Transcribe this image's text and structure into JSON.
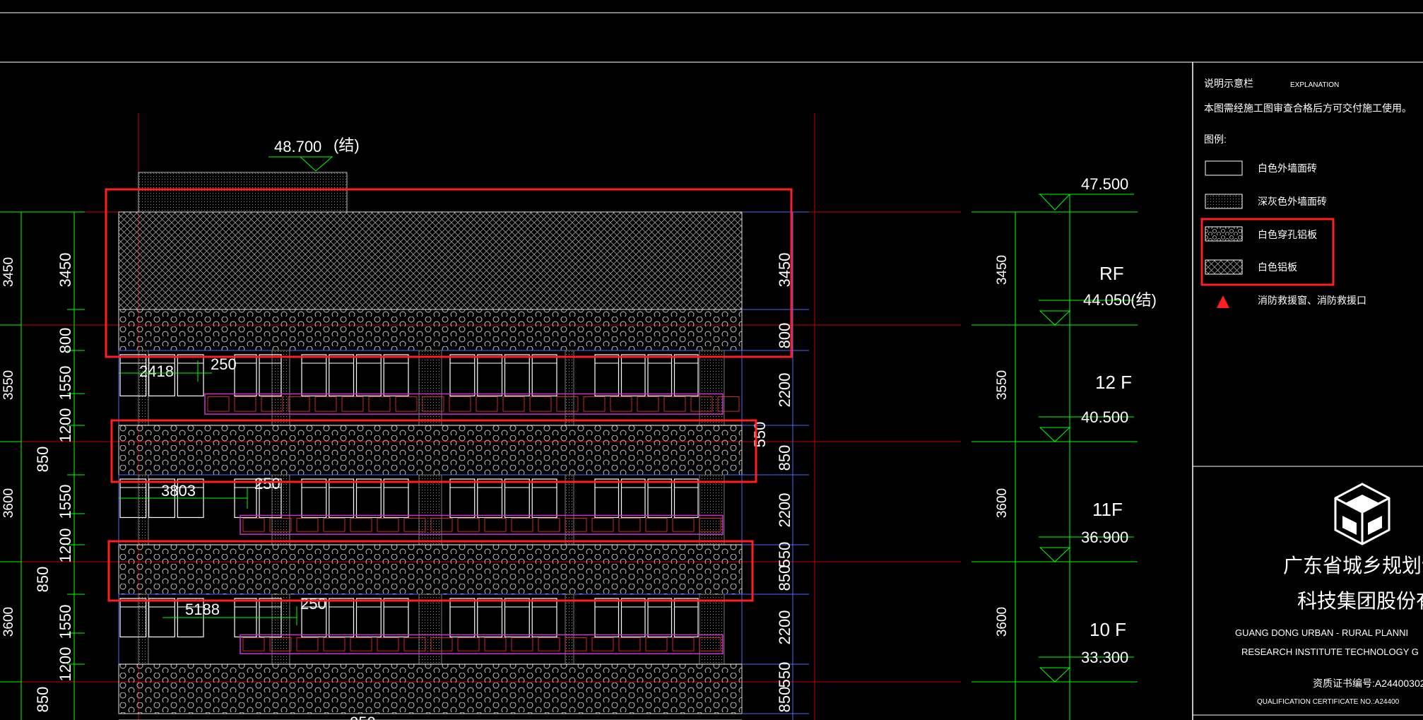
{
  "legend_panel": {
    "title_cn": "说明示意栏",
    "title_en": "EXPLANATION",
    "note": "本图需经施工图审查合格后方可交付施工使用。",
    "legend_heading": "图例:",
    "items": [
      {
        "label": "白色外墙面砖",
        "pattern": "plain"
      },
      {
        "label": "深灰色外墙面砖",
        "pattern": "dots"
      },
      {
        "label": "白色穿孔铝板",
        "pattern": "circles"
      },
      {
        "label": "白色铝板",
        "pattern": "crosshatch"
      },
      {
        "label": "消防救援窗、消防救援口",
        "pattern": "red-triangle"
      }
    ]
  },
  "company": {
    "name_cn_line1": "广东省城乡规划设计研",
    "name_cn_line2": "科技集团股份有限公",
    "name_en_line1": "GUANG DONG URBAN - RURAL PLANNI",
    "name_en_line2": "RESEARCH INSTITUTE TECHNOLOGY G",
    "cert_cn": "资质证书编号:A24400302",
    "cert_en": "QUALIFICATION CERTIFICATE NO.:A24400"
  },
  "elevation": {
    "top_level": "48.700",
    "top_level_note": "(结)",
    "levels": [
      {
        "value": "47.500",
        "floor": ""
      },
      {
        "value": "44.050(结)",
        "floor": "RF"
      },
      {
        "value": "40.500",
        "floor": "12 F"
      },
      {
        "value": "36.900",
        "floor": "11F"
      },
      {
        "value": "33.300",
        "floor": "10 F"
      }
    ],
    "left_dims_outer": [
      "3450",
      "3550",
      "3600",
      "3600"
    ],
    "left_dims_inner": [
      "3450",
      "800",
      "1550",
      "1200",
      "850",
      "1550",
      "1200",
      "850",
      "1550",
      "1200",
      "850"
    ],
    "right_dims_inner": [
      "3450",
      "800",
      "2200",
      "550",
      "850",
      "2200",
      "550",
      "850",
      "2200",
      "550",
      "850"
    ],
    "right_dims_outer": [
      "3450",
      "3550",
      "3600",
      "3600"
    ],
    "window_dims": [
      {
        "width": "2418",
        "gap": "250"
      },
      {
        "width": "3803",
        "gap": "250"
      },
      {
        "width": "5188",
        "gap": "250"
      }
    ],
    "partial_dim": "250"
  },
  "colors": {
    "background": "#000000",
    "highlight": "#ff1f1f",
    "dimension": "#00ff00",
    "axis": "#c00000",
    "wall_line": "#ffffff",
    "railing": "#cc33cc",
    "grid_blue": "#4d6aff",
    "panel_border": "#c8c8c8"
  }
}
